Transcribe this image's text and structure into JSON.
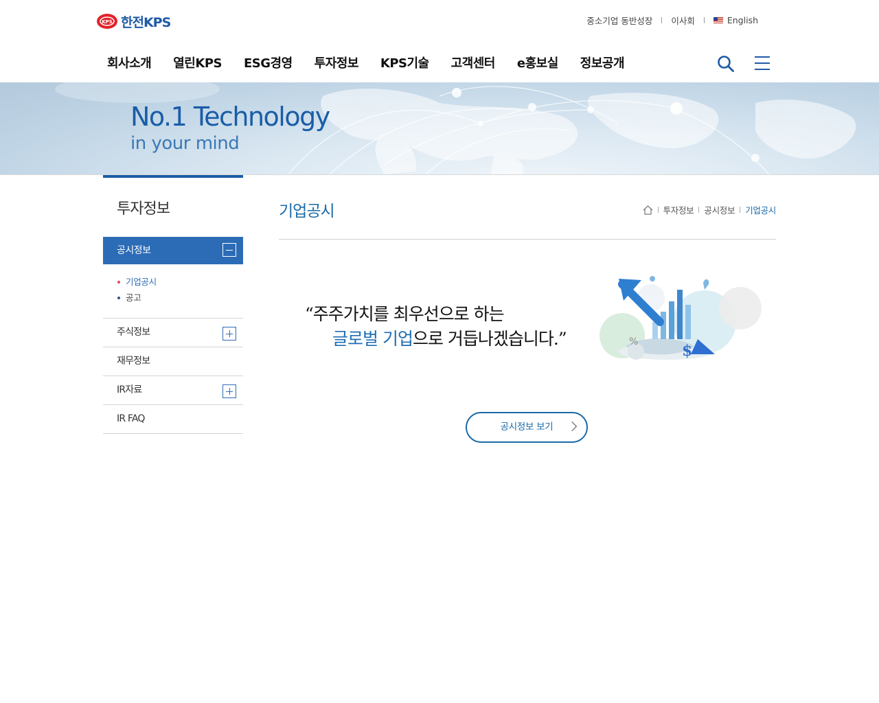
{
  "header": {
    "logo_text": "한전KPS",
    "util_links": [
      "중소기업 동반성장",
      "이사회",
      "English"
    ],
    "gnb": [
      "회사소개",
      "열린KPS",
      "ESG경영",
      "투자정보",
      "KPS기술",
      "고객센터",
      "e홍보실",
      "정보공개"
    ]
  },
  "hero": {
    "title": "No.1 Technology",
    "subtitle": "in your mind"
  },
  "lnb": {
    "title": "투자정보",
    "active_section": "공시정보",
    "sub_items": [
      "기업공시",
      "공고"
    ],
    "items": [
      "주식정보",
      "재무정보",
      "IR자료",
      "IR FAQ"
    ]
  },
  "content": {
    "title": "기업공시",
    "breadcrumb": [
      "투자정보",
      "공시정보",
      "기업공시"
    ],
    "slogan_line1": "“주주가치를 최우선으로 하는",
    "slogan_line2_highlight": "글로벌 기업",
    "slogan_line2_rest": "으로 거듭나겠습니다.”",
    "button_label": "공시정보 보기"
  },
  "colors": {
    "brand_blue": "#1a5da6",
    "active_menu": "#2c6cb6",
    "accent_red": "#e24a5a"
  },
  "icons": [
    "home-icon",
    "search-icon",
    "menu-icon",
    "us-flag-icon",
    "chevron-right-icon",
    "minus-icon",
    "plus-icon"
  ]
}
